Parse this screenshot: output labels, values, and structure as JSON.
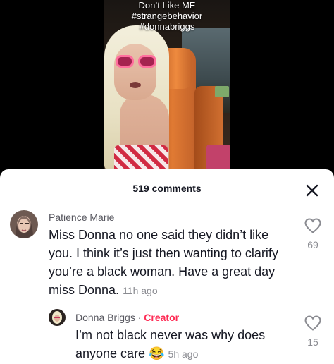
{
  "video": {
    "caption_lines": [
      "Don’t Like ME",
      "#strangebehavior",
      "#donnabriggs"
    ]
  },
  "comments_panel": {
    "count_label": "519 comments",
    "close_icon": "close-icon"
  },
  "comments": [
    {
      "username": "Patience Marie",
      "text": "Miss Donna no one said they didn’t like you. I think it’s just then wanting to clarify you’re a black woman. Have a great day miss Donna.",
      "timestamp": "11h ago",
      "likes": "69"
    }
  ],
  "replies": [
    {
      "username": "Donna Briggs",
      "separator": "·",
      "badge": "Creator",
      "text": "I’m not black never was why does anyone care",
      "emoji": "😂",
      "timestamp": "5h ago",
      "likes": "15"
    }
  ],
  "colors": {
    "creator_badge": "#fe2c55",
    "text_primary": "#161823",
    "text_secondary": "#8a8b91"
  }
}
